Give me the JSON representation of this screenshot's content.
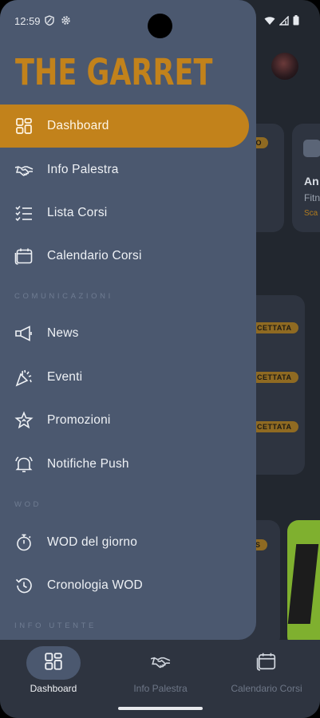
{
  "status_bar": {
    "time": "12:59",
    "left_icons": [
      "shield-icon",
      "gear-icon"
    ],
    "right_icons": [
      "wifi-icon",
      "signal-icon",
      "battery-icon"
    ]
  },
  "drawer": {
    "brand": "THE GARRET",
    "accent_color": "#c2821b",
    "items": [
      {
        "label": "Dashboard",
        "icon": "dashboard-icon",
        "active": true
      },
      {
        "label": "Info Palestra",
        "icon": "handshake-icon",
        "active": false
      },
      {
        "label": "Lista Corsi",
        "icon": "checklist-icon",
        "active": false
      },
      {
        "label": "Calendario Corsi",
        "icon": "calendar-icon",
        "active": false
      }
    ],
    "sections": [
      {
        "title": "COMUNICAZIONI",
        "items": [
          {
            "label": "News",
            "icon": "megaphone-icon"
          },
          {
            "label": "Eventi",
            "icon": "party-icon"
          },
          {
            "label": "Promozioni",
            "icon": "star-badge-icon"
          },
          {
            "label": "Notifiche Push",
            "icon": "bell-icon"
          }
        ]
      },
      {
        "title": "WOD",
        "items": [
          {
            "label": "WOD del giorno",
            "icon": "stopwatch-icon"
          },
          {
            "label": "Cronologia WOD",
            "icon": "history-icon"
          }
        ]
      },
      {
        "title": "INFO UTENTE",
        "items": []
      }
    ]
  },
  "background": {
    "badge_1": "VO",
    "card_title": "An",
    "card_sub": "Fitn",
    "card_accent": "Sca",
    "badges": [
      "CETTATA",
      "CETTATA",
      "CETTATA"
    ],
    "badge_4": "S"
  },
  "bottom_nav": {
    "items": [
      {
        "label": "Dashboard",
        "icon": "dashboard-icon",
        "active": true
      },
      {
        "label": "Info Palestra",
        "icon": "handshake-icon",
        "active": false
      },
      {
        "label": "Calendario Corsi",
        "icon": "calendar-icon",
        "active": false
      }
    ]
  }
}
